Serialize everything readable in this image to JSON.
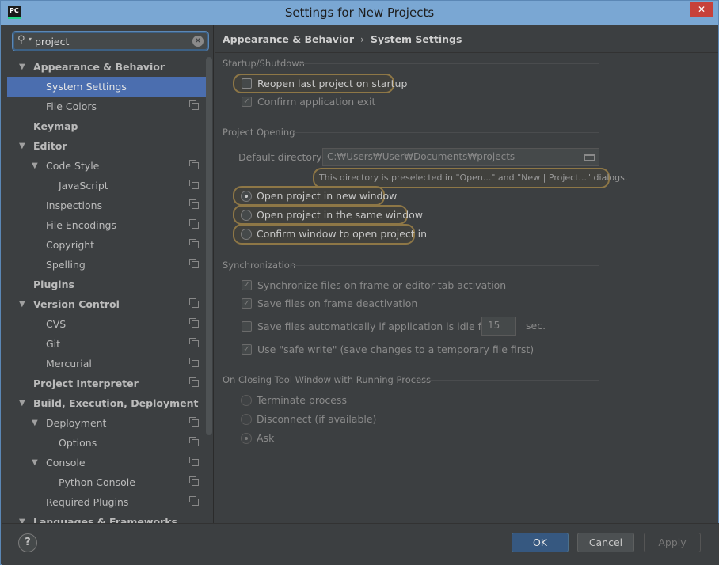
{
  "window": {
    "title": "Settings for New Projects",
    "app_icon": "PC",
    "close": "✕"
  },
  "search": {
    "value": "project",
    "icon": "search-icon",
    "clear_icon": "close-icon"
  },
  "tree": [
    {
      "label": "Appearance & Behavior",
      "level": 0,
      "expanded": true,
      "bold": true,
      "copy": false
    },
    {
      "label": "System Settings",
      "level": 1,
      "selected": true,
      "copy": false
    },
    {
      "label": "File Colors",
      "level": 1,
      "copy": true
    },
    {
      "label": "Keymap",
      "level": 0,
      "bold": true,
      "copy": false
    },
    {
      "label": "Editor",
      "level": 0,
      "expanded": true,
      "bold": true,
      "copy": false
    },
    {
      "label": "Code Style",
      "level": 1,
      "expanded": true,
      "copy": true
    },
    {
      "label": "JavaScript",
      "level": 2,
      "copy": true
    },
    {
      "label": "Inspections",
      "level": 1,
      "copy": true
    },
    {
      "label": "File Encodings",
      "level": 1,
      "copy": true
    },
    {
      "label": "Copyright",
      "level": 1,
      "copy": true
    },
    {
      "label": "Spelling",
      "level": 1,
      "copy": true
    },
    {
      "label": "Plugins",
      "level": 0,
      "bold": true,
      "copy": false
    },
    {
      "label": "Version Control",
      "level": 0,
      "expanded": true,
      "bold": true,
      "copy": true
    },
    {
      "label": "CVS",
      "level": 1,
      "copy": true
    },
    {
      "label": "Git",
      "level": 1,
      "copy": true
    },
    {
      "label": "Mercurial",
      "level": 1,
      "copy": true
    },
    {
      "label": "Project Interpreter",
      "level": 0,
      "bold": true,
      "copy": true
    },
    {
      "label": "Build, Execution, Deployment",
      "level": 0,
      "expanded": true,
      "bold": true,
      "copy": false
    },
    {
      "label": "Deployment",
      "level": 1,
      "expanded": true,
      "copy": true
    },
    {
      "label": "Options",
      "level": 2,
      "copy": true
    },
    {
      "label": "Console",
      "level": 1,
      "expanded": true,
      "copy": true
    },
    {
      "label": "Python Console",
      "level": 2,
      "copy": true
    },
    {
      "label": "Required Plugins",
      "level": 1,
      "copy": true
    },
    {
      "label": "Languages & Frameworks",
      "level": 0,
      "expanded": true,
      "bold": true,
      "copy": false
    }
  ],
  "breadcrumb": {
    "root": "Appearance & Behavior",
    "separator": "›",
    "current": "System Settings"
  },
  "startup": {
    "title": "Startup/Shutdown",
    "reopen_label": "Reopen last project on startup",
    "reopen_checked": false,
    "confirm_exit_label": "Confirm application exit",
    "confirm_exit_checked": true
  },
  "project_opening": {
    "title": "Project Opening",
    "default_dir_label": "Default directory:",
    "default_dir_value": "C:₩Users₩User₩Documents₩projects",
    "hint": "This directory is preselected in \"Open...\" and \"New | Project...\" dialogs.",
    "radio_new_window": "Open project in new window",
    "radio_same_window": "Open project in the same window",
    "radio_confirm": "Confirm window to open project in",
    "selected": "new_window"
  },
  "sync": {
    "title": "Synchronization",
    "sync_files_label": "Synchronize files on frame or editor tab activation",
    "save_deactivation_label": "Save files on frame deactivation",
    "save_idle_label": "Save files automatically if application is idle for",
    "idle_value": "15",
    "idle_unit": "sec.",
    "safe_write_label": "Use \"safe write\" (save changes to a temporary file first)"
  },
  "closing": {
    "title": "On Closing Tool Window with Running Process",
    "terminate_label": "Terminate process",
    "disconnect_label": "Disconnect (if available)",
    "ask_label": "Ask",
    "selected": "ask"
  },
  "footer": {
    "help": "?",
    "ok": "OK",
    "cancel": "Cancel",
    "apply": "Apply"
  }
}
